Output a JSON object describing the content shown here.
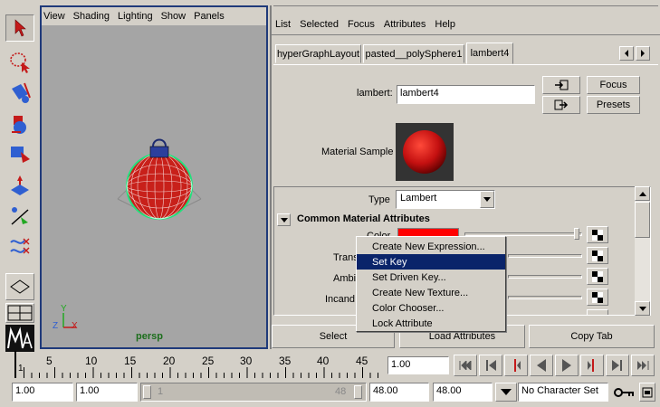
{
  "toolbox": {
    "tools": [
      "select-tool",
      "lasso-tool",
      "paint-tool",
      "move-tool",
      "rotate-tool",
      "scale-tool",
      "manipulator-tool",
      "split-tool",
      "show-manipulator-tool"
    ],
    "bottom_tools": [
      "layout-single",
      "layout-four",
      "layout-maya-logo"
    ]
  },
  "viewport": {
    "menu": [
      "View",
      "Shading",
      "Lighting",
      "Show",
      "Panels"
    ],
    "camera_label": "persp",
    "axis_labels": {
      "x": "X",
      "y": "Y",
      "z": "Z"
    }
  },
  "attribute_editor": {
    "menu": [
      "List",
      "Selected",
      "Focus",
      "Attributes",
      "Help"
    ],
    "tabs": [
      "hyperGraphLayout",
      "pasted__polySphere1",
      "lambert4"
    ],
    "active_tab": "lambert4",
    "node_type_label": "lambert:",
    "node_name": "lambert4",
    "focus_label": "Focus",
    "presets_label": "Presets",
    "material_sample_label": "Material Sample",
    "type_label": "Type",
    "type_value": "Lambert",
    "section_title": "Common Material Attributes",
    "attr_labels": [
      "Color",
      "Trans",
      "Ambi",
      "Incand"
    ],
    "color_value": "#ff0000",
    "bottom_buttons": [
      "Select",
      "Load Attributes",
      "Copy Tab"
    ]
  },
  "context_menu": {
    "items": [
      "Create New Expression...",
      "Set Key",
      "Set Driven Key...",
      "Create New Texture...",
      "Color Chooser...",
      "Lock Attribute"
    ],
    "selected_index": 1
  },
  "timeline": {
    "ticks": [
      "1",
      "5",
      "10",
      "15",
      "20",
      "25",
      "30",
      "35",
      "40",
      "45"
    ],
    "current_frame": "1.00"
  },
  "range": {
    "start": "1.00",
    "playback_start": "1.00",
    "slider_start": "1",
    "slider_end": "48",
    "playback_end": "48.00",
    "end": "48.00",
    "character_set": "No Character Set"
  }
}
